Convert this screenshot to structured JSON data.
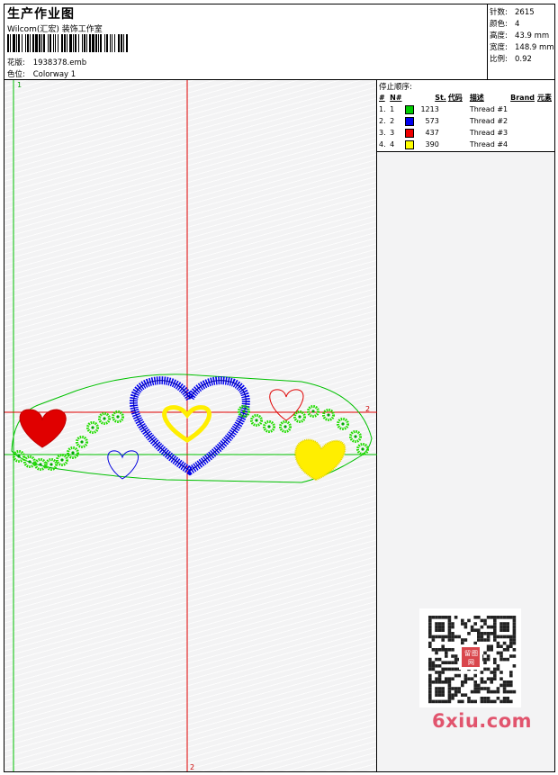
{
  "header": {
    "title": "生产作业图",
    "company": "Wilcom(汇宏) 装饰工作室",
    "design_label": "花版:",
    "design_value": "1938378.emb",
    "colorway_label": "色位:",
    "colorway_value": "Colorway 1"
  },
  "stats": {
    "stitches_label": "针数:",
    "stitches_value": "2615",
    "colors_label": "颜色:",
    "colors_value": "4",
    "height_label": "高度:",
    "height_value": "43.9 mm",
    "width_label": "宽度:",
    "width_value": "148.9 mm",
    "scale_label": "比例:",
    "scale_value": "0.92"
  },
  "stops": {
    "title": "停止顺序:",
    "headers": [
      "#",
      "N#",
      "",
      "St.",
      "代码",
      "描述",
      "Brand",
      "元素"
    ],
    "rows": [
      {
        "num": "1.",
        "needle": "1",
        "color": "#00cc00",
        "stitches": "1213",
        "code": "",
        "desc": "Thread #1"
      },
      {
        "num": "2.",
        "needle": "2",
        "color": "#0000ee",
        "stitches": "573",
        "code": "",
        "desc": "Thread #2"
      },
      {
        "num": "3.",
        "needle": "3",
        "color": "#ee0000",
        "stitches": "437",
        "code": "",
        "desc": "Thread #3"
      },
      {
        "num": "4.",
        "needle": "4",
        "color": "#ffff00",
        "stitches": "390",
        "code": "",
        "desc": "Thread #4"
      }
    ]
  },
  "canvas": {
    "marker_top": "1",
    "marker_right": "2",
    "marker_bottom": "2"
  },
  "qr": {
    "stamp_text": [
      "留",
      "图",
      "网"
    ]
  },
  "watermark": {
    "text": "6xiu.com"
  }
}
